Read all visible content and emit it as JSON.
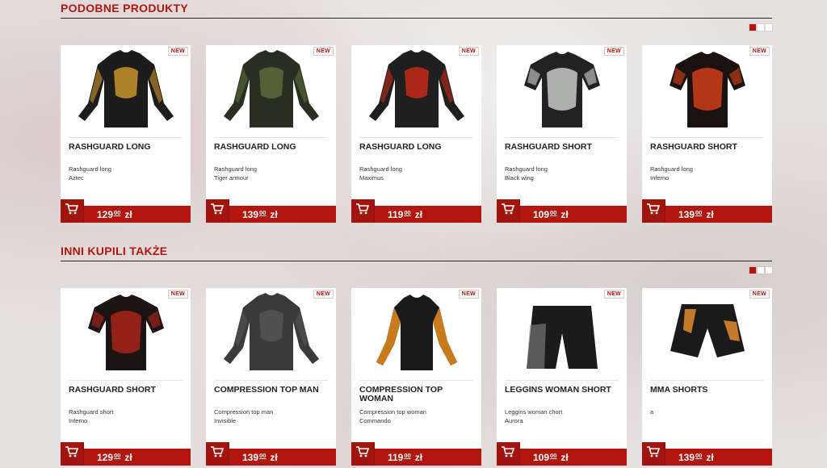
{
  "sections": [
    {
      "title": "PODOBNE PRODUKTY",
      "pager_pages": 3,
      "products": [
        {
          "badge": "NEW",
          "title": "RASHGUARD LONG",
          "line1": "Rashguard long",
          "line2": "Aztec",
          "price_main": "129",
          "price_cents": "00",
          "currency": "zł",
          "image": "long-sleeve-shirt",
          "color_main": "#1c1c1c",
          "color_accent": "#c8952a"
        },
        {
          "badge": "NEW",
          "title": "RASHGUARD LONG",
          "line1": "Rashguard long",
          "line2": "Tiger armour",
          "price_main": "139",
          "price_cents": "00",
          "currency": "zł",
          "image": "long-sleeve-shirt",
          "color_main": "#2a2e22",
          "color_accent": "#5a6b3a"
        },
        {
          "badge": "NEW",
          "title": "RASHGUARD LONG",
          "line1": "Rashguard long",
          "line2": "Maximus",
          "price_main": "119",
          "price_cents": "00",
          "currency": "zł",
          "image": "long-sleeve-shirt",
          "color_main": "#1f1f1f",
          "color_accent": "#c22a1a"
        },
        {
          "badge": "NEW",
          "title": "RASHGUARD SHORT",
          "line1": "Rashguard long",
          "line2": "Black wing",
          "price_main": "109",
          "price_cents": "00",
          "currency": "zł",
          "image": "short-sleeve-shirt",
          "color_main": "#222222",
          "color_accent": "#cfd3cf"
        },
        {
          "badge": "NEW",
          "title": "RASHGUARD SHORT",
          "line1": "Rashguard long",
          "line2": "Inferno",
          "price_main": "139",
          "price_cents": "00",
          "currency": "zł",
          "image": "short-sleeve-shirt",
          "color_main": "#1a1210",
          "color_accent": "#d8401a"
        }
      ]
    },
    {
      "title": "INNI KUPILI TAKŻE",
      "pager_pages": 3,
      "products": [
        {
          "badge": "NEW",
          "title": "RASHGUARD SHORT",
          "line1": "Rashguard short",
          "line2": "Inferno",
          "price_main": "129",
          "price_cents": "00",
          "currency": "zł",
          "image": "short-sleeve-shirt",
          "color_main": "#1c1414",
          "color_accent": "#b02418"
        },
        {
          "badge": "NEW",
          "title": "COMPRESSION TOP MAN",
          "line1": "Compression top man",
          "line2": "Invisible",
          "price_main": "139",
          "price_cents": "00",
          "currency": "zł",
          "image": "long-sleeve-shirt",
          "color_main": "#3a3a3a",
          "color_accent": "#555555"
        },
        {
          "badge": "NEW",
          "title": "COMPRESSION TOP WOMAN",
          "line1": "Compression top woman",
          "line2": "Commando",
          "price_main": "119",
          "price_cents": "00",
          "currency": "zł",
          "image": "womens-top",
          "color_main": "#1a1a1a",
          "color_accent": "#c87a1c"
        },
        {
          "badge": "NEW",
          "title": "LEGGINS WOMAN SHORT",
          "line1": "Leggins woman chort",
          "line2": "Aurora",
          "price_main": "109",
          "price_cents": "00",
          "currency": "zł",
          "image": "shorts",
          "color_main": "#1b1b1b",
          "color_accent": "#8c8c8c"
        },
        {
          "badge": "NEW",
          "title": "MMA SHORTS",
          "line1": "a",
          "line2": "",
          "price_main": "139",
          "price_cents": "00",
          "currency": "zł",
          "image": "mma-shorts",
          "color_main": "#1a1a1a",
          "color_accent": "#c47a2a"
        }
      ]
    }
  ]
}
